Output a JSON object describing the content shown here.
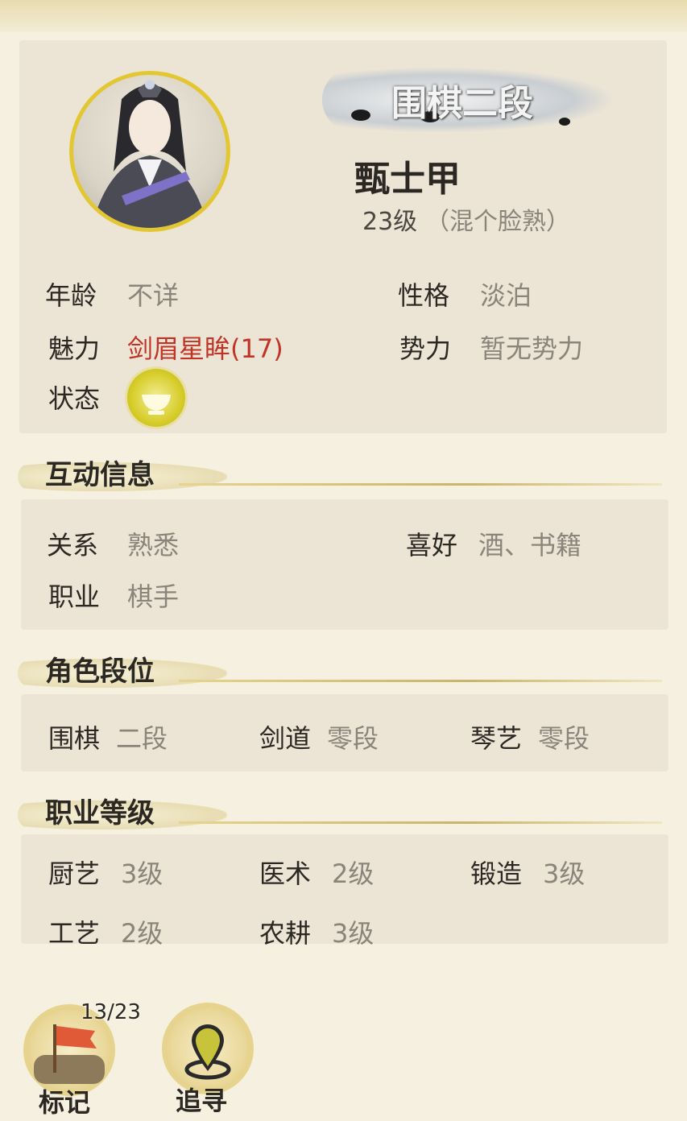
{
  "profile": {
    "rank_badge": "围棋二段",
    "name": "甄士甲",
    "level": "23级",
    "level_desc": "（混个脸熟）"
  },
  "attributes": {
    "age_label": "年龄",
    "age_value": "不详",
    "personality_label": "性格",
    "personality_value": "淡泊",
    "charm_label": "魅力",
    "charm_value": "剑眉星眸(17)",
    "faction_label": "势力",
    "faction_value": "暂无势力",
    "status_label": "状态",
    "status_icon": "bowl-icon"
  },
  "interaction": {
    "title": "互动信息",
    "relation_label": "关系",
    "relation_value": "熟悉",
    "hobby_label": "喜好",
    "hobby_value": "酒、书籍",
    "job_label": "职业",
    "job_value": "棋手"
  },
  "ranks": {
    "title": "角色段位",
    "items": [
      {
        "label": "围棋",
        "value": "二段"
      },
      {
        "label": "剑道",
        "value": "零段"
      },
      {
        "label": "琴艺",
        "value": "零段"
      }
    ]
  },
  "jobs": {
    "title": "职业等级",
    "items": [
      {
        "label": "厨艺",
        "value": "3级"
      },
      {
        "label": "医术",
        "value": "2级"
      },
      {
        "label": "锻造",
        "value": "3级"
      },
      {
        "label": "工艺",
        "value": "2级"
      },
      {
        "label": "农耕",
        "value": "3级"
      }
    ]
  },
  "actions": {
    "mark_label": "标记",
    "mark_count": "13/23",
    "trace_label": "追寻"
  },
  "colors": {
    "accent_red": "#c03426",
    "gold": "#e2c730",
    "panel": "#ece5d6",
    "background": "#f5f0df"
  }
}
